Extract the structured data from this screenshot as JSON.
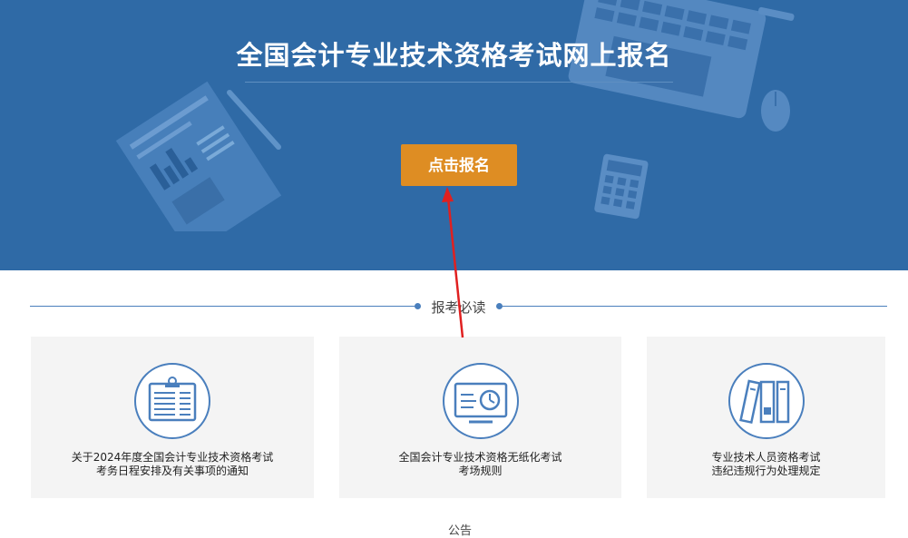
{
  "hero": {
    "title": "全国会计专业技术资格考试网上报名",
    "cta_label": "点击报名"
  },
  "section": {
    "heading": "报考必读"
  },
  "cards": [
    {
      "line1": "关于2024年度全国会计专业技术资格考试",
      "line2": "考务日程安排及有关事项的通知",
      "icon": "clipboard-schedule-icon"
    },
    {
      "line1": "全国会计专业技术资格无纸化考试",
      "line2": "考场规则",
      "icon": "monitor-clock-icon"
    },
    {
      "line1": "专业技术人员资格考试",
      "line2": "违纪违规行为处理规定",
      "icon": "binders-icon"
    }
  ],
  "bottom": {
    "partial_heading": "公告"
  },
  "colors": {
    "hero_bg": "#2f6aa6",
    "cta": "#de8d23",
    "accent": "#4a7fbd",
    "card_bg": "#f4f4f4",
    "annotation_arrow": "#e02020"
  }
}
